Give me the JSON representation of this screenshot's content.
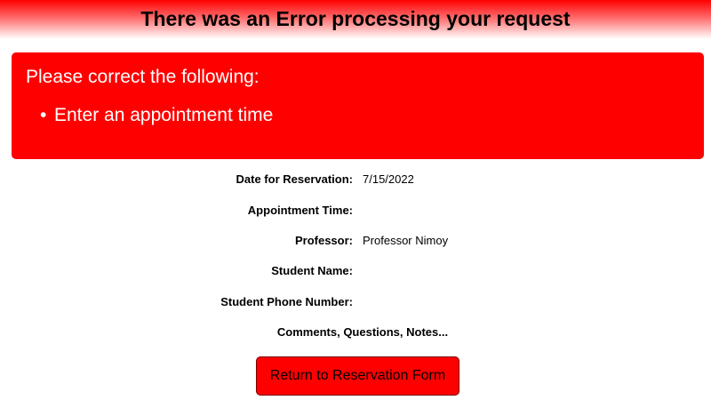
{
  "header": {
    "title": "There was an Error processing your request"
  },
  "error_box": {
    "heading": "Please correct the following:",
    "items": [
      "Enter an appointment time"
    ]
  },
  "details": {
    "date": {
      "label": "Date for Reservation:",
      "value": "7/15/2022"
    },
    "time": {
      "label": "Appointment Time:",
      "value": ""
    },
    "professor": {
      "label": "Professor:",
      "value": "Professor Nimoy"
    },
    "student_name": {
      "label": "Student Name:",
      "value": ""
    },
    "student_phone": {
      "label": "Student Phone Number:",
      "value": ""
    },
    "comments_label": "Comments, Questions, Notes..."
  },
  "actions": {
    "return_label": "Return to Reservation Form"
  },
  "colors": {
    "error_red": "#ff0000",
    "text_on_error": "#ffffff"
  }
}
